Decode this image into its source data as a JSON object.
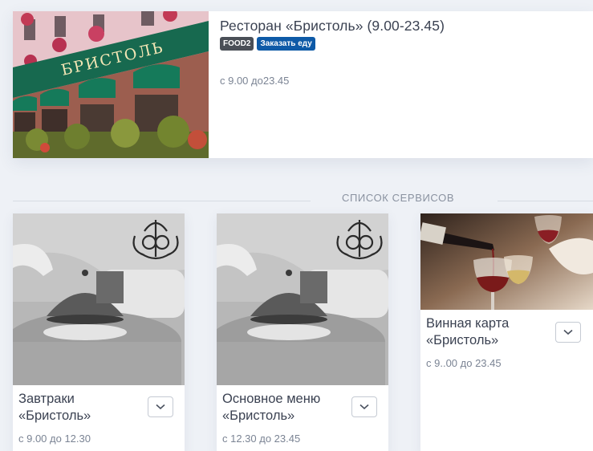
{
  "restaurant": {
    "title": "Ресторан «Бристоль» (9.00-23.45)",
    "photo_sign": "БРИСТОЛЬ",
    "badges": [
      "FOOD2",
      "Заказать еду"
    ],
    "hours": "с 9.00 до23.45"
  },
  "section": {
    "title": "СПИСОК СЕРВИСОВ"
  },
  "services": [
    {
      "name_line1": "Завтраки",
      "name_line2": "«Бристоль»",
      "hours": "с 9.00 до 12.30",
      "icon": "chevron-down-icon"
    },
    {
      "name_line1": "Основное меню",
      "name_line2": "«Бристоль»",
      "hours": "с 12.30 до 23.45",
      "icon": "chevron-down-icon"
    },
    {
      "name_line1": "Винная карта",
      "name_line2": "«Бристоль»",
      "hours": "с 9..00 до 23.45",
      "icon": "chevron-down-icon"
    }
  ],
  "colors": {
    "background": "#eef1f6",
    "badge_dark": "#4a4f57",
    "badge_blue": "#0e5aa7",
    "awning_green": "#17694f"
  }
}
